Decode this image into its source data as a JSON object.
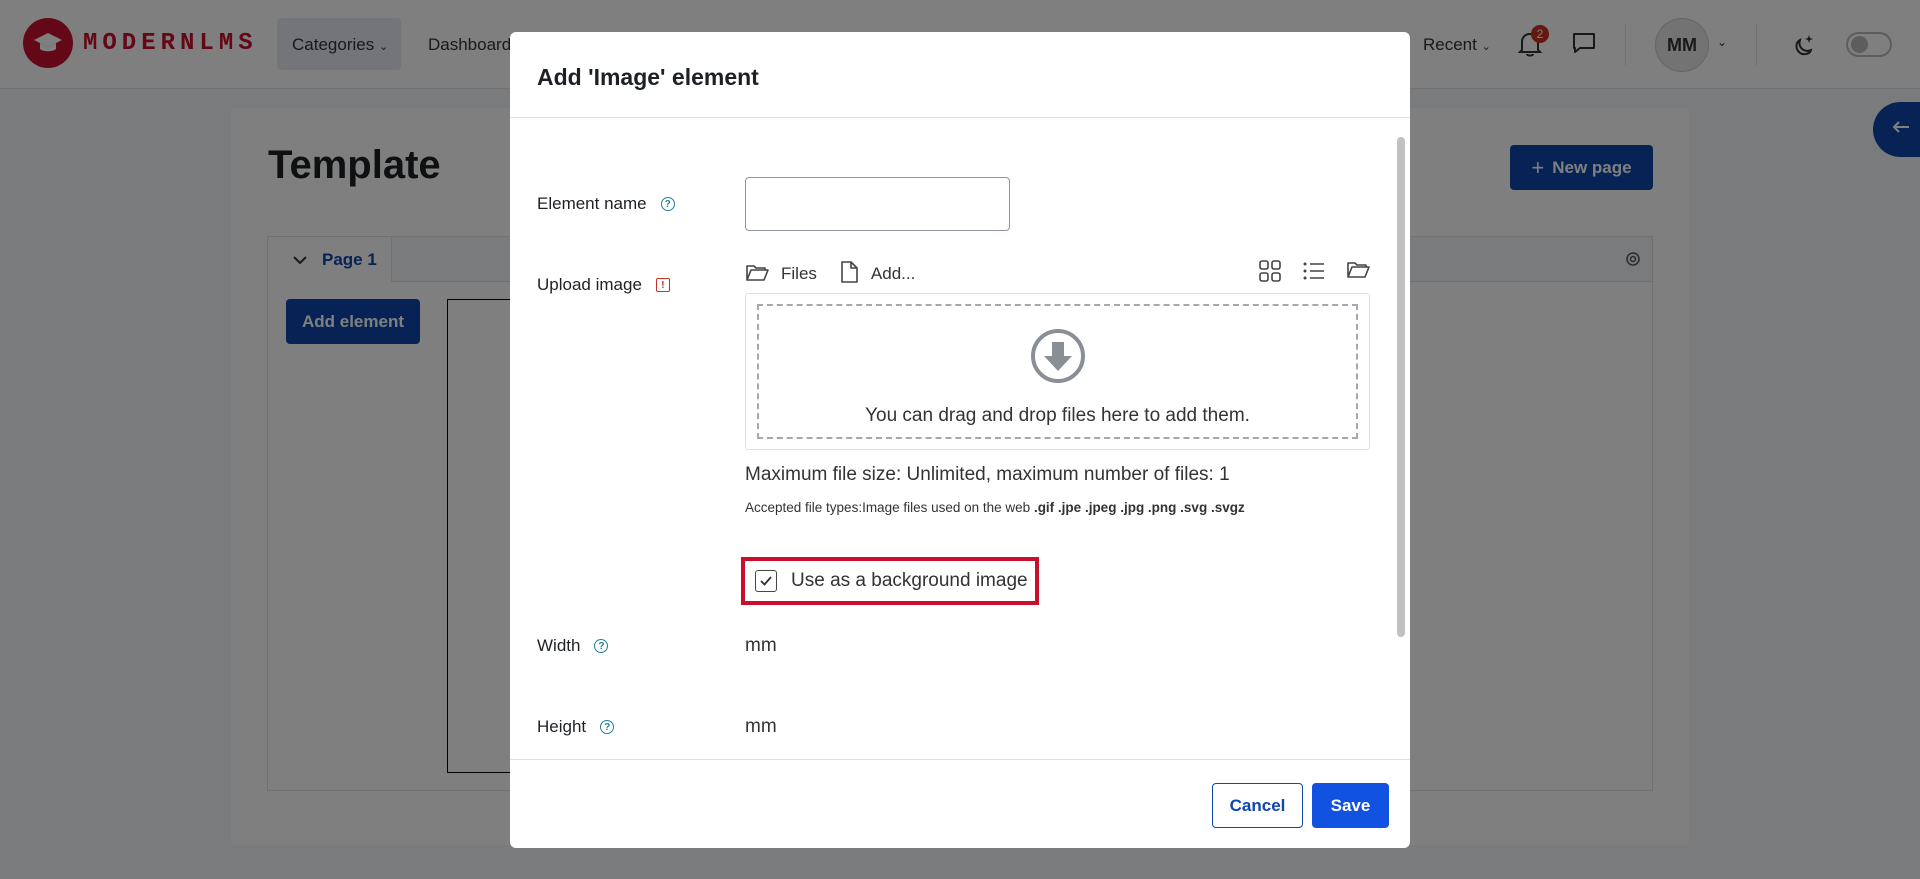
{
  "navbar": {
    "logo_text": "MODERNLMS",
    "items": [
      "Categories",
      "Dashboard"
    ],
    "recent_label": "Recent",
    "notification_count": "2",
    "avatar_initials": "MM"
  },
  "page": {
    "title": "Template",
    "new_page_label": "New page",
    "tab_label": "Page 1",
    "add_element_label": "Add element"
  },
  "modal": {
    "title": "Add 'Image' element",
    "fields": {
      "element_name_label": "Element name",
      "element_name_value": "",
      "upload_image_label": "Upload image",
      "width_label": "Width",
      "height_label": "Height",
      "width_unit": "mm",
      "height_unit": "mm"
    },
    "filepicker": {
      "files_label": "Files",
      "add_label": "Add...",
      "drop_text": "You can drag and drop files here to add them.",
      "max_size_text": "Maximum file size: Unlimited, maximum number of files: 1",
      "accepted_prefix": "Accepted file types:Image files used on the web",
      "accepted_types": ".gif .jpe .jpeg .jpg .png .svg .svgz"
    },
    "background_checkbox": {
      "label": "Use as a background image",
      "checked": true
    },
    "footer": {
      "cancel_label": "Cancel",
      "save_label": "Save"
    }
  },
  "colors": {
    "brand_red": "#c8102e",
    "primary_blue": "#0f47ad",
    "save_blue": "#1152e0",
    "help_teal": "#1f7e9a"
  }
}
